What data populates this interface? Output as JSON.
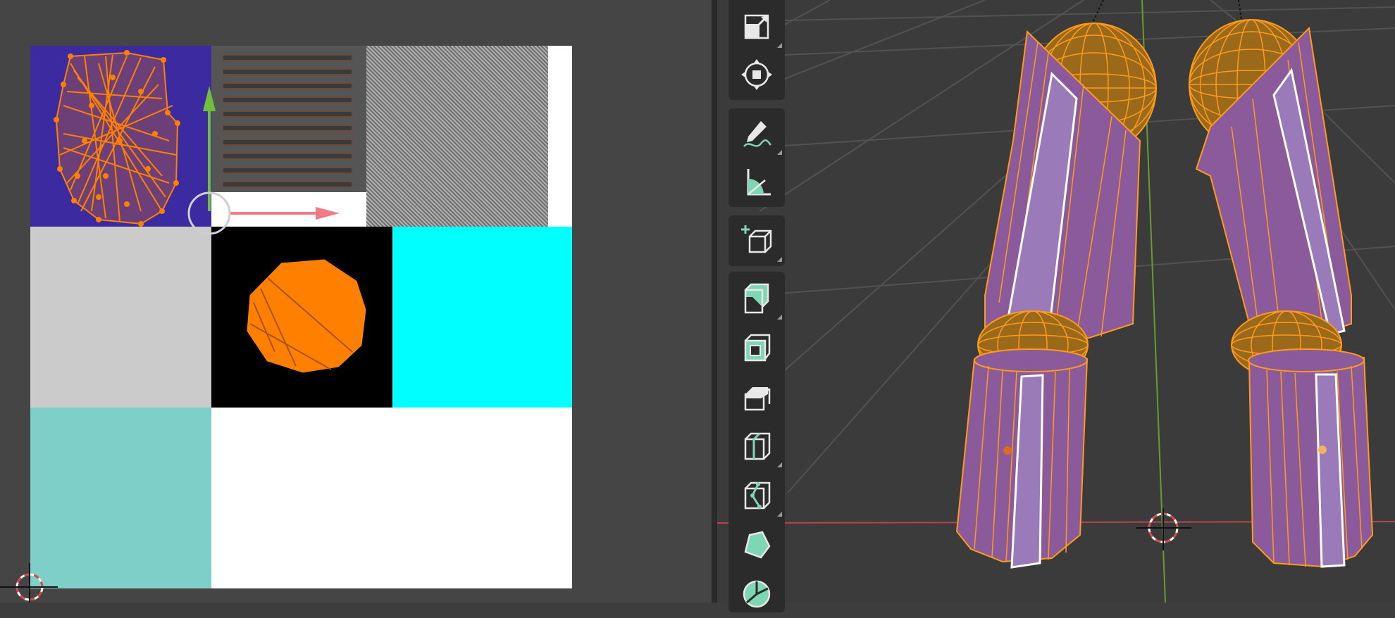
{
  "window": {
    "title": ""
  },
  "uv_editor": {
    "image_tiles": [
      {
        "name": "tile-uv-islands",
        "color": "#3b2aa0"
      },
      {
        "name": "tile-metal-grille",
        "color": "#555555"
      },
      {
        "name": "tile-noise-pattern",
        "color": "#8a8a8a"
      },
      {
        "name": "tile-white-strip",
        "color": "#ffffff"
      },
      {
        "name": "tile-light-gray",
        "color": "#cbcbcb"
      },
      {
        "name": "tile-black-mesh",
        "color": "#000000"
      },
      {
        "name": "tile-cyan",
        "color": "#00ffff"
      },
      {
        "name": "tile-teal",
        "color": "#7ecfc8"
      },
      {
        "name": "tile-white-large",
        "color": "#ffffff"
      }
    ],
    "gizmo": {
      "x_axis_color": "#f07a85",
      "y_axis_color": "#6fbf3f"
    },
    "selection_color": "#ff8000"
  },
  "viewport": {
    "grid_color": "#525252",
    "x_axis_color": "#b8434f",
    "y_axis_color": "#6a9a32",
    "mesh_face_color": "#8b5a9a",
    "mesh_edge_color": "#ff9a1a",
    "sphere_color": "#9a6a1a"
  },
  "toolbar": {
    "tools": [
      {
        "name": "scale-tool",
        "icon": "scale-icon"
      },
      {
        "name": "transform-tool",
        "icon": "transform-icon"
      },
      {
        "name": "annotate-tool",
        "icon": "annotate-icon"
      },
      {
        "name": "measure-tool",
        "icon": "measure-icon"
      },
      {
        "name": "add-cube-tool",
        "icon": "add-cube-icon"
      },
      {
        "name": "extrude-region-tool",
        "icon": "extrude-region-icon"
      },
      {
        "name": "inset-faces-tool",
        "icon": "inset-faces-icon"
      },
      {
        "name": "bevel-tool",
        "icon": "bevel-icon"
      },
      {
        "name": "loop-cut-tool",
        "icon": "loop-cut-icon"
      },
      {
        "name": "knife-tool",
        "icon": "knife-icon"
      },
      {
        "name": "poly-build-tool",
        "icon": "poly-build-icon"
      },
      {
        "name": "spin-tool",
        "icon": "spin-icon"
      }
    ]
  }
}
